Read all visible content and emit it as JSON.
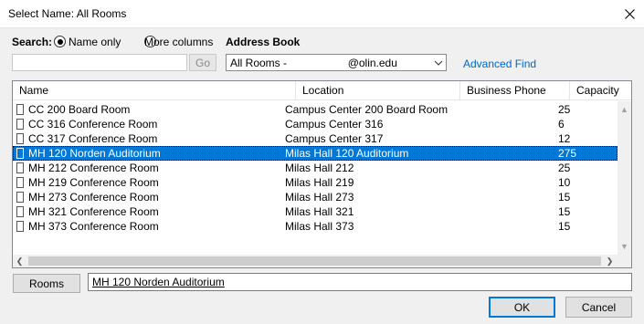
{
  "window": {
    "title": "Select Name: All Rooms"
  },
  "search": {
    "label": "Search:",
    "option_name_only": "Name only",
    "option_more_columns": "More columns",
    "input_value": "",
    "go_label": "Go"
  },
  "address_book": {
    "label": "Address Book",
    "selected": "All Rooms -                    @olin.edu",
    "advanced_find": "Advanced Find"
  },
  "table": {
    "columns": [
      "Name",
      "Location",
      "Business Phone",
      "Capacity"
    ],
    "rows": [
      {
        "name": "CC 200 Board Room",
        "location": "Campus Center 200 Board Room",
        "phone": "",
        "capacity": "25"
      },
      {
        "name": "CC 316 Conference Room",
        "location": "Campus Center 316",
        "phone": "",
        "capacity": "6"
      },
      {
        "name": "CC 317 Conference Room",
        "location": "Campus Center 317",
        "phone": "",
        "capacity": "12"
      },
      {
        "name": "MH 120 Norden Auditorium",
        "location": "Milas Hall 120 Auditorium",
        "phone": "",
        "capacity": "275"
      },
      {
        "name": "MH 212 Conference Room",
        "location": "Milas Hall 212",
        "phone": "",
        "capacity": "25"
      },
      {
        "name": "MH 219 Conference Room",
        "location": "Milas Hall 219",
        "phone": "",
        "capacity": "10"
      },
      {
        "name": "MH 273 Conference Room",
        "location": "Milas Hall 273",
        "phone": "",
        "capacity": "15"
      },
      {
        "name": "MH 321 Conference Room",
        "location": "Milas Hall 321",
        "phone": "",
        "capacity": "15"
      },
      {
        "name": "MH 373 Conference Room",
        "location": "Milas Hall 373",
        "phone": "",
        "capacity": "15"
      }
    ]
  },
  "footer": {
    "rooms_button": "Rooms",
    "selected_value": "MH 120 Norden Auditorium",
    "ok": "OK",
    "cancel": "Cancel"
  },
  "colors": {
    "selection": "#0078d7",
    "link": "#0066cc"
  }
}
